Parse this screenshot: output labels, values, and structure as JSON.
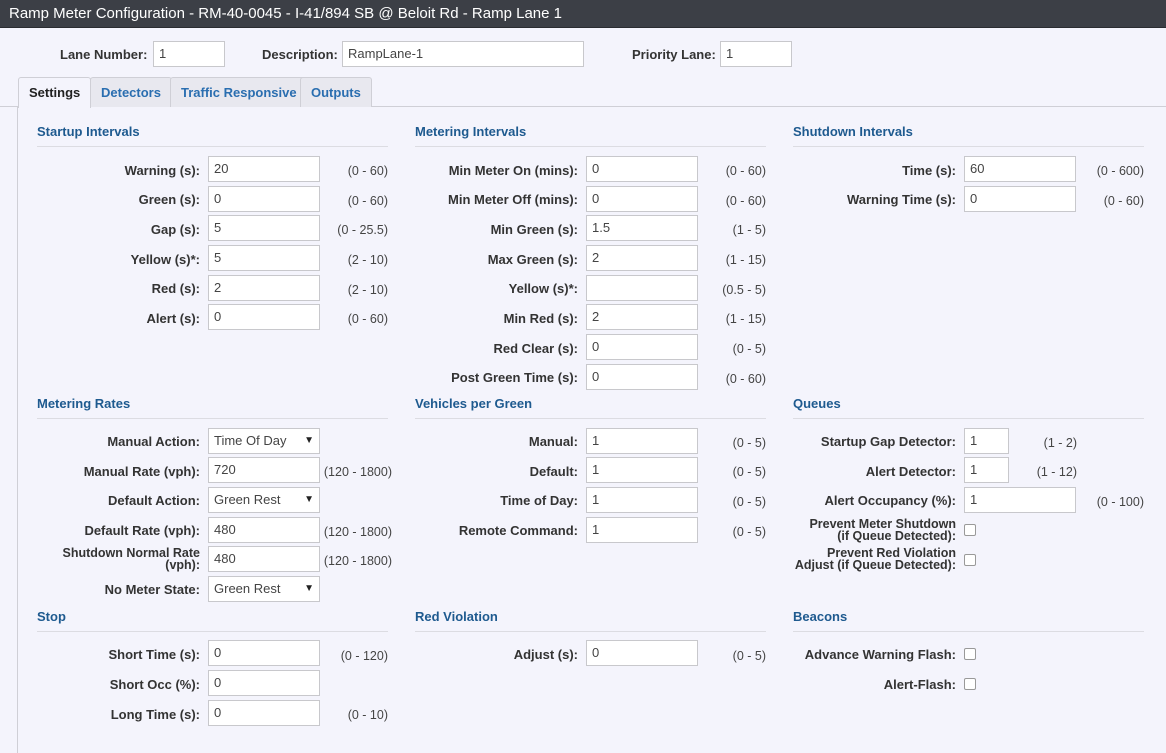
{
  "window": {
    "title": "Ramp Meter Configuration - RM-40-0045 - I-41/894 SB @ Beloit Rd - Ramp Lane 1"
  },
  "header": {
    "lane_number_label": "Lane Number:",
    "lane_number_value": "1",
    "description_label": "Description:",
    "description_value": "RampLane-1",
    "priority_label": "Priority Lane:",
    "priority_value": "1"
  },
  "tabs": [
    "Settings",
    "Detectors",
    "Traffic Responsive",
    "Outputs"
  ],
  "startup": {
    "title": "Startup Intervals",
    "rows": [
      {
        "label": "Warning (s):",
        "value": "20",
        "range": "(0 - 60)"
      },
      {
        "label": "Green (s):",
        "value": "0",
        "range": "(0 - 60)"
      },
      {
        "label": "Gap (s):",
        "value": "5",
        "range": "(0 - 25.5)"
      },
      {
        "label": "Yellow (s)*:",
        "value": "5",
        "range": "(2 - 10)"
      },
      {
        "label": "Red (s):",
        "value": "2",
        "range": "(2 - 10)"
      },
      {
        "label": "Alert (s):",
        "value": "0",
        "range": "(0 - 60)"
      }
    ]
  },
  "metering": {
    "title": "Metering Intervals",
    "rows": [
      {
        "label": "Min Meter On (mins):",
        "value": "0",
        "range": "(0 - 60)"
      },
      {
        "label": "Min Meter Off (mins):",
        "value": "0",
        "range": "(0 - 60)"
      },
      {
        "label": "Min Green (s):",
        "value": "1.5",
        "range": "(1 - 5)"
      },
      {
        "label": "Max Green (s):",
        "value": "2",
        "range": "(1 - 15)"
      },
      {
        "label": "Yellow (s)*:",
        "value": "",
        "range": "(0.5 - 5)"
      },
      {
        "label": "Min Red (s):",
        "value": "2",
        "range": "(1 - 15)"
      },
      {
        "label": "Red Clear (s):",
        "value": "0",
        "range": "(0 - 5)"
      },
      {
        "label": "Post Green Time (s):",
        "value": "0",
        "range": "(0 - 60)"
      }
    ]
  },
  "shutdown": {
    "title": "Shutdown Intervals",
    "rows": [
      {
        "label": "Time (s):",
        "value": "60",
        "range": "(0 - 600)"
      },
      {
        "label": "Warning Time (s):",
        "value": "0",
        "range": "(0 - 60)"
      }
    ]
  },
  "rates": {
    "title": "Metering Rates",
    "manual_action_label": "Manual Action:",
    "manual_action_value": "Time Of Day",
    "manual_rate_label": "Manual Rate (vph):",
    "manual_rate_value": "720",
    "manual_rate_range": "(120 - 1800)",
    "default_action_label": "Default Action:",
    "default_action_value": "Green Rest",
    "default_rate_label": "Default Rate (vph):",
    "default_rate_value": "480",
    "default_rate_range": "(120 - 1800)",
    "shutdown_rate_label_1": "Shutdown Normal Rate",
    "shutdown_rate_label_2": "(vph):",
    "shutdown_rate_value": "480",
    "shutdown_rate_range": "(120 - 1800)",
    "no_meter_label": "No Meter State:",
    "no_meter_value": "Green Rest"
  },
  "vpg": {
    "title": "Vehicles per Green",
    "rows": [
      {
        "label": "Manual:",
        "value": "1",
        "range": "(0 - 5)"
      },
      {
        "label": "Default:",
        "value": "1",
        "range": "(0 - 5)"
      },
      {
        "label": "Time of Day:",
        "value": "1",
        "range": "(0 - 5)"
      },
      {
        "label": "Remote Command:",
        "value": "1",
        "range": "(0 - 5)"
      }
    ]
  },
  "queues": {
    "title": "Queues",
    "startup_gap_label": "Startup Gap Detector:",
    "startup_gap_value": "1",
    "startup_gap_range": "(1 - 2)",
    "alert_det_label": "Alert Detector:",
    "alert_det_value": "1",
    "alert_det_range": "(1 - 12)",
    "alert_occ_label": "Alert Occupancy (%):",
    "alert_occ_value": "1",
    "alert_occ_range": "(0 - 100)",
    "prevent_shutdown_1": "Prevent Meter Shutdown",
    "prevent_shutdown_2": "(if Queue Detected):",
    "prevent_red_1": "Prevent Red Violation",
    "prevent_red_2": "Adjust (if Queue Detected):"
  },
  "stop": {
    "title": "Stop",
    "short_time_label": "Short Time (s):",
    "short_time_value": "0",
    "short_time_range": "(0 - 120)",
    "short_occ_label": "Short Occ (%):",
    "short_occ_value": "0",
    "long_time_label": "Long Time (s):",
    "long_time_value": "0",
    "long_time_range": "(0 - 10)"
  },
  "redviol": {
    "title": "Red Violation",
    "adjust_label": "Adjust (s):",
    "adjust_value": "0",
    "adjust_range": "(0 - 5)"
  },
  "beacons": {
    "title": "Beacons",
    "advance_label": "Advance Warning Flash:",
    "alert_flash_label": "Alert-Flash:"
  },
  "icons": {
    "dropdown": "chevron-down-icon"
  },
  "colors": {
    "section_title": "#1e5a8f",
    "tab_link": "#2a6eb0",
    "titlebar": "#3c3f46"
  }
}
